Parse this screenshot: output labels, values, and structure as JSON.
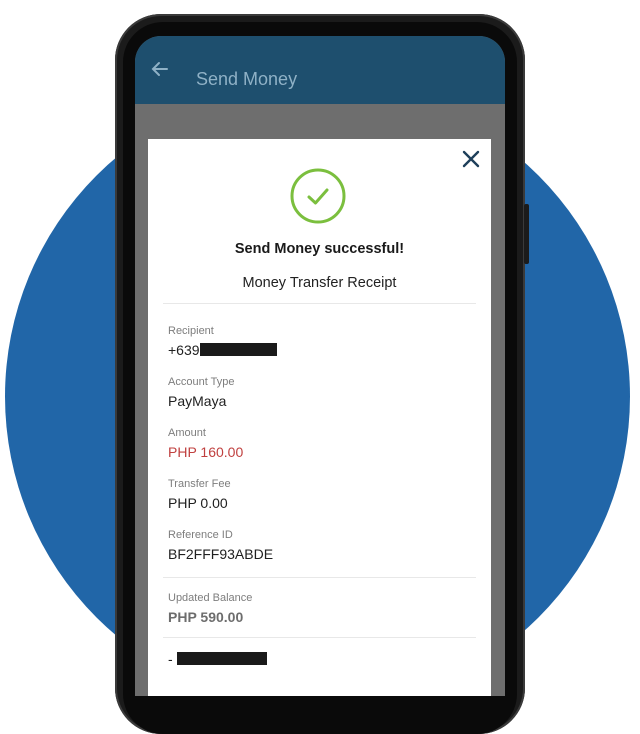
{
  "appbar": {
    "title": "Send Money",
    "back_icon": "arrow-left-icon"
  },
  "modal": {
    "success_message": "Send Money successful!",
    "receipt_title": "Money Transfer Receipt",
    "close_icon": "close-icon",
    "check_icon": "check-circle-icon",
    "accent_color": "#7bbf3e"
  },
  "fields": {
    "recipient": {
      "label": "Recipient",
      "value": "+639"
    },
    "account_type": {
      "label": "Account Type",
      "value": "PayMaya"
    },
    "amount": {
      "label": "Amount",
      "value": "PHP 160.00"
    },
    "transfer_fee": {
      "label": "Transfer Fee",
      "value": "PHP 0.00"
    },
    "reference_id": {
      "label": "Reference ID",
      "value": "BF2FFF93ABDE"
    },
    "updated_balance": {
      "label": "Updated Balance",
      "value": "PHP 590.00"
    },
    "extra": {
      "value": "-"
    }
  },
  "colors": {
    "circle": "#2166a8",
    "appbar": "#1e4f6e",
    "amount_red": "#c0403f"
  }
}
